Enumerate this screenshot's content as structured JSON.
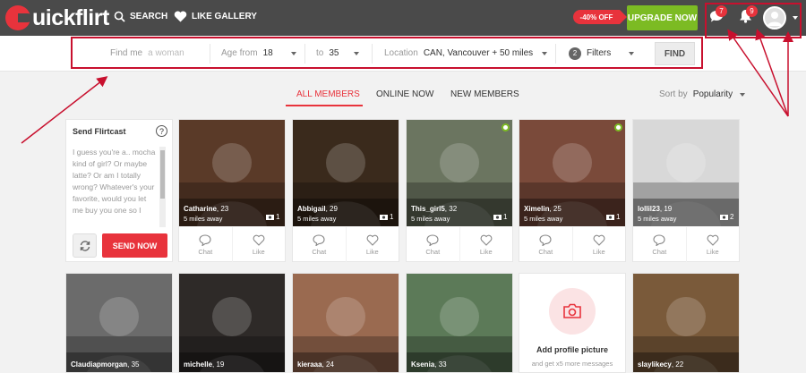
{
  "header": {
    "logo_text": "uickflirt",
    "nav": [
      {
        "label": "SEARCH",
        "icon": "search-icon"
      },
      {
        "label": "LIKE GALLERY",
        "icon": "heart-icon"
      }
    ],
    "discount": "-40% OFF",
    "upgrade_label": "UPGRADE NOW",
    "messages_count": "7",
    "notifications_count": "9"
  },
  "filters": {
    "find_me_label": "Find me",
    "find_me_value": "a woman",
    "age_from_label": "Age from",
    "age_from_value": "18",
    "age_to_label": "to",
    "age_to_value": "35",
    "location_label": "Location",
    "location_value": "CAN, Vancouver + 50 miles",
    "filters_count": "2",
    "filters_label": "Filters",
    "find_button": "FIND"
  },
  "tabs": [
    "ALL MEMBERS",
    "ONLINE NOW",
    "NEW MEMBERS"
  ],
  "sort": {
    "label": "Sort by",
    "value": "Popularity"
  },
  "flirtcast": {
    "title": "Send Flirtcast",
    "help": "?",
    "message": "I guess you're a.. mocha kind of girl? Or maybe latte? Or am I totally wrong? Whatever's your favorite, would you let me buy you one so I",
    "send_label": "SEND NOW"
  },
  "actions": {
    "chat": "Chat",
    "like": "Like"
  },
  "members": [
    {
      "name": "Catharine",
      "age": "23",
      "distance": "5 miles away",
      "photos": "1",
      "online": false,
      "bg": "#5a3a28"
    },
    {
      "name": "Abbigail",
      "age": "29",
      "distance": "5 miles away",
      "photos": "1",
      "online": false,
      "bg": "#3a2a1c"
    },
    {
      "name": "This_girl5",
      "age": "32",
      "distance": "5 miles away",
      "photos": "1",
      "online": true,
      "bg": "#6b7560"
    },
    {
      "name": "Ximelin",
      "age": "25",
      "distance": "5 miles away",
      "photos": "1",
      "online": true,
      "bg": "#7a4a3a"
    },
    {
      "name": "lollil23",
      "age": "19",
      "distance": "5 miles away",
      "photos": "2",
      "online": false,
      "bg": "#d8d8d8"
    }
  ],
  "members_row2": [
    {
      "name": "Claudiapmorgan",
      "age": "35",
      "bg": "#6b6b6b"
    },
    {
      "name": "michelle",
      "age": "19",
      "bg": "#2e2a28"
    },
    {
      "name": "kieraaa",
      "age": "24",
      "bg": "#9a6a50"
    },
    {
      "name": "Ksenia",
      "age": "33",
      "bg": "#5c7a58"
    },
    {
      "name": "slaylikecy",
      "age": "22",
      "bg": "#7a5a3a"
    }
  ],
  "add_picture": {
    "title": "Add profile picture",
    "subtitle": "and get x5 more messages"
  }
}
